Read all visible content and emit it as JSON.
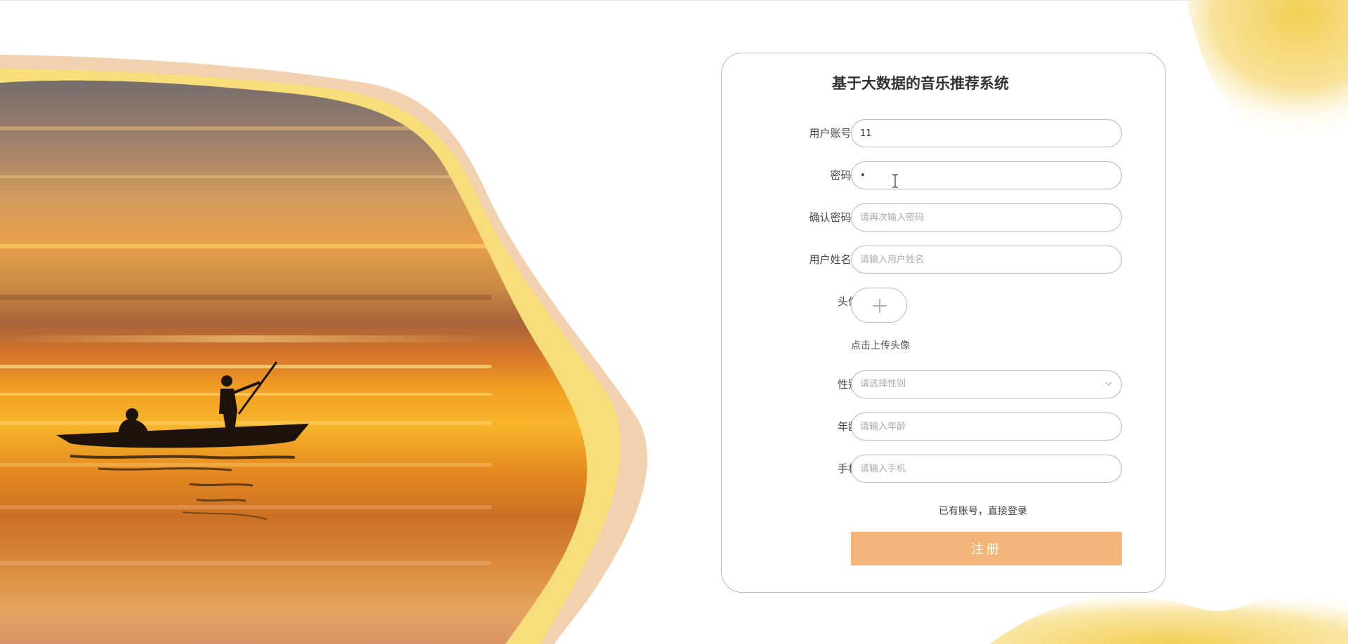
{
  "form": {
    "title": "基于大数据的音乐推荐系统",
    "account": {
      "label": "用户账号:",
      "required": "*",
      "value": "11"
    },
    "password": {
      "label": "密码:",
      "required": "*",
      "value": "•"
    },
    "confirm_password": {
      "label": "确认密码:",
      "required": "*",
      "placeholder": "请再次输入密码"
    },
    "user_name": {
      "label": "用户姓名:",
      "required": "*",
      "placeholder": "请输入用户姓名"
    },
    "avatar": {
      "label": "头像:",
      "hint": "点击上传头像"
    },
    "gender": {
      "label": "性别:",
      "placeholder": "请选择性别"
    },
    "age": {
      "label": "年龄:",
      "placeholder": "请输入年龄"
    },
    "phone": {
      "label": "手机:",
      "placeholder": "请输入手机"
    },
    "login_link": "已有账号，直接登录",
    "submit_label": "注册"
  },
  "icons": {
    "upload": "plus-icon",
    "gender_dropdown": "chevron-down-icon",
    "cursor": "text-cursor-icon"
  },
  "colors": {
    "accent_button": "#f2b57a",
    "required_mark": "#e03a3a",
    "border": "#b9b9b9",
    "wave_yellow": "#f7de7a",
    "wave_peach": "#f2d1b0"
  }
}
